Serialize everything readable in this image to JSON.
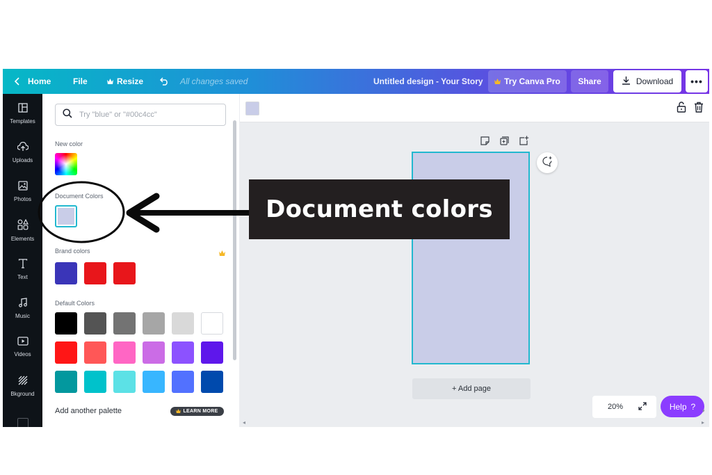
{
  "topbar": {
    "home_label": "Home",
    "file_label": "File",
    "resize_label": "Resize",
    "saved_status": "All changes saved",
    "design_title": "Untitled design - Your Story",
    "try_pro_label": "Try Canva Pro",
    "share_label": "Share",
    "download_label": "Download",
    "more_label": "•••"
  },
  "leftnav": {
    "items": [
      {
        "label": "Templates",
        "icon": "templates-icon"
      },
      {
        "label": "Uploads",
        "icon": "cloud-upload-icon"
      },
      {
        "label": "Photos",
        "icon": "image-icon"
      },
      {
        "label": "Elements",
        "icon": "shapes-icon"
      },
      {
        "label": "Text",
        "icon": "text-icon"
      },
      {
        "label": "Music",
        "icon": "music-note-icon"
      },
      {
        "label": "Videos",
        "icon": "video-icon"
      },
      {
        "label": "Bkground",
        "icon": "background-pattern-icon"
      }
    ]
  },
  "color_panel": {
    "search_placeholder": "Try \"blue\" or \"#00c4cc\"",
    "new_color_label": "New color",
    "document_colors_label": "Document Colors",
    "document_colors": [
      "#c9cde8"
    ],
    "brand_colors_label": "Brand colors",
    "brand_colors": [
      "#3a35b8",
      "#e8161b",
      "#e8161b"
    ],
    "default_colors_label": "Default Colors",
    "default_colors": [
      [
        "#000000",
        "#545454",
        "#737373",
        "#a6a6a6",
        "#d9d9d9",
        "#ffffff"
      ],
      [
        "#ff1616",
        "#ff5757",
        "#ff66c4",
        "#cb6ce6",
        "#8c52ff",
        "#5e17eb"
      ],
      [
        "#03989e",
        "#00c2cb",
        "#5ce1e6",
        "#38b6ff",
        "#5271ff",
        "#004aad"
      ]
    ],
    "add_palette_label": "Add another palette",
    "learn_more_label": "LEARN MORE"
  },
  "canvas": {
    "page_color": "#c9cde8",
    "add_page_label": "+ Add page",
    "zoom_level": "20%",
    "help_label": "Help",
    "help_icon": "?"
  },
  "annotation": {
    "text": "Document colors"
  },
  "colors": {
    "accent": "#22b8cf",
    "help_purple": "#8b3dff",
    "crown_gold": "#f5b828",
    "nav_bg": "#0e1318"
  }
}
